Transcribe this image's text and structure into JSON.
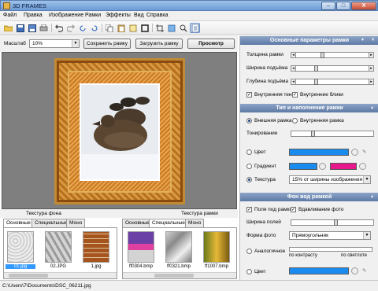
{
  "window": {
    "title": "3D FRAMES",
    "minimize": "–",
    "maximize": "□",
    "close": "X"
  },
  "menu": [
    "Файл",
    "Правка",
    "Изображение",
    "Рамки",
    "Эффекты",
    "Вид",
    "Справка"
  ],
  "toolbar_icons": [
    "open-folder-icon",
    "save-icon",
    "save-as-icon",
    "print-icon",
    "undo-icon",
    "redo-icon",
    "rotate-left-icon",
    "rotate-right-icon",
    "copy-icon",
    "paste-icon",
    "export-icon",
    "frame-icon",
    "crop-icon",
    "text-icon",
    "zoom-icon",
    "page-icon"
  ],
  "controls": {
    "zoom_label": "Масштаб",
    "zoom_value": "10%",
    "save_frame": "Сохранить рамку",
    "load_frame": "Загрузить рамку",
    "preview": "Просмотр"
  },
  "bottom": {
    "bg_texture_label": "Текстура фона",
    "frame_texture_label": "Текстура рамки",
    "left_tabs": [
      "Основные",
      "Специальные",
      "Моно"
    ],
    "right_tabs": [
      "Основные",
      "Специальные",
      "Моно"
    ],
    "left_thumbs": [
      "01.jpg",
      "02.JPG",
      "1.jpg"
    ],
    "right_thumbs": [
      "ff0304.bmp",
      "ff0321.bmp",
      "ff1007.bmp"
    ]
  },
  "status": {
    "path": "C:\\Users\\7\\Documents\\DSC_06211.jpg"
  },
  "panel1": {
    "title": "Основные параметры рамки",
    "frame_thickness": "Толщина рамки",
    "lift_width": "Ширина подъёма",
    "lift_depth": "Глубина подъёма",
    "inner_shadow": "Внутренняя тень",
    "inner_highlights": "Внутренние блики",
    "levels": {
      "frame_thickness": 0.35,
      "lift_width": 0.25,
      "lift_depth": 0.25
    }
  },
  "panel2": {
    "title": "Тип и наполнение рамки",
    "outer_frame": "Внешняя рамка",
    "inner_frame": "Внутренняя рамка",
    "tinting": "Тонирование",
    "color": "Цвет",
    "gradient": "Градиент",
    "texture": "Текстура",
    "texture_option": "15% от ширины изображения",
    "tint_level": 0.2
  },
  "panel3": {
    "title": "Фон вод рамкой",
    "bg_under_frame": "Поля под рамкой",
    "press_photo": "Вдавливание фото",
    "field_width": "Ширина полей",
    "photo_shape": "Форма фото",
    "photo_shape_value": "Прямоугольник",
    "similar": "Аналогичное",
    "by_contrast": "по контрасту",
    "by_brightness": "по светлоте",
    "color": "Цвет",
    "field_width_level": 0.55
  },
  "colors": {
    "blue": "#1a8cf0",
    "pink": "#e6188c",
    "panel_header": "#6f89b3"
  }
}
